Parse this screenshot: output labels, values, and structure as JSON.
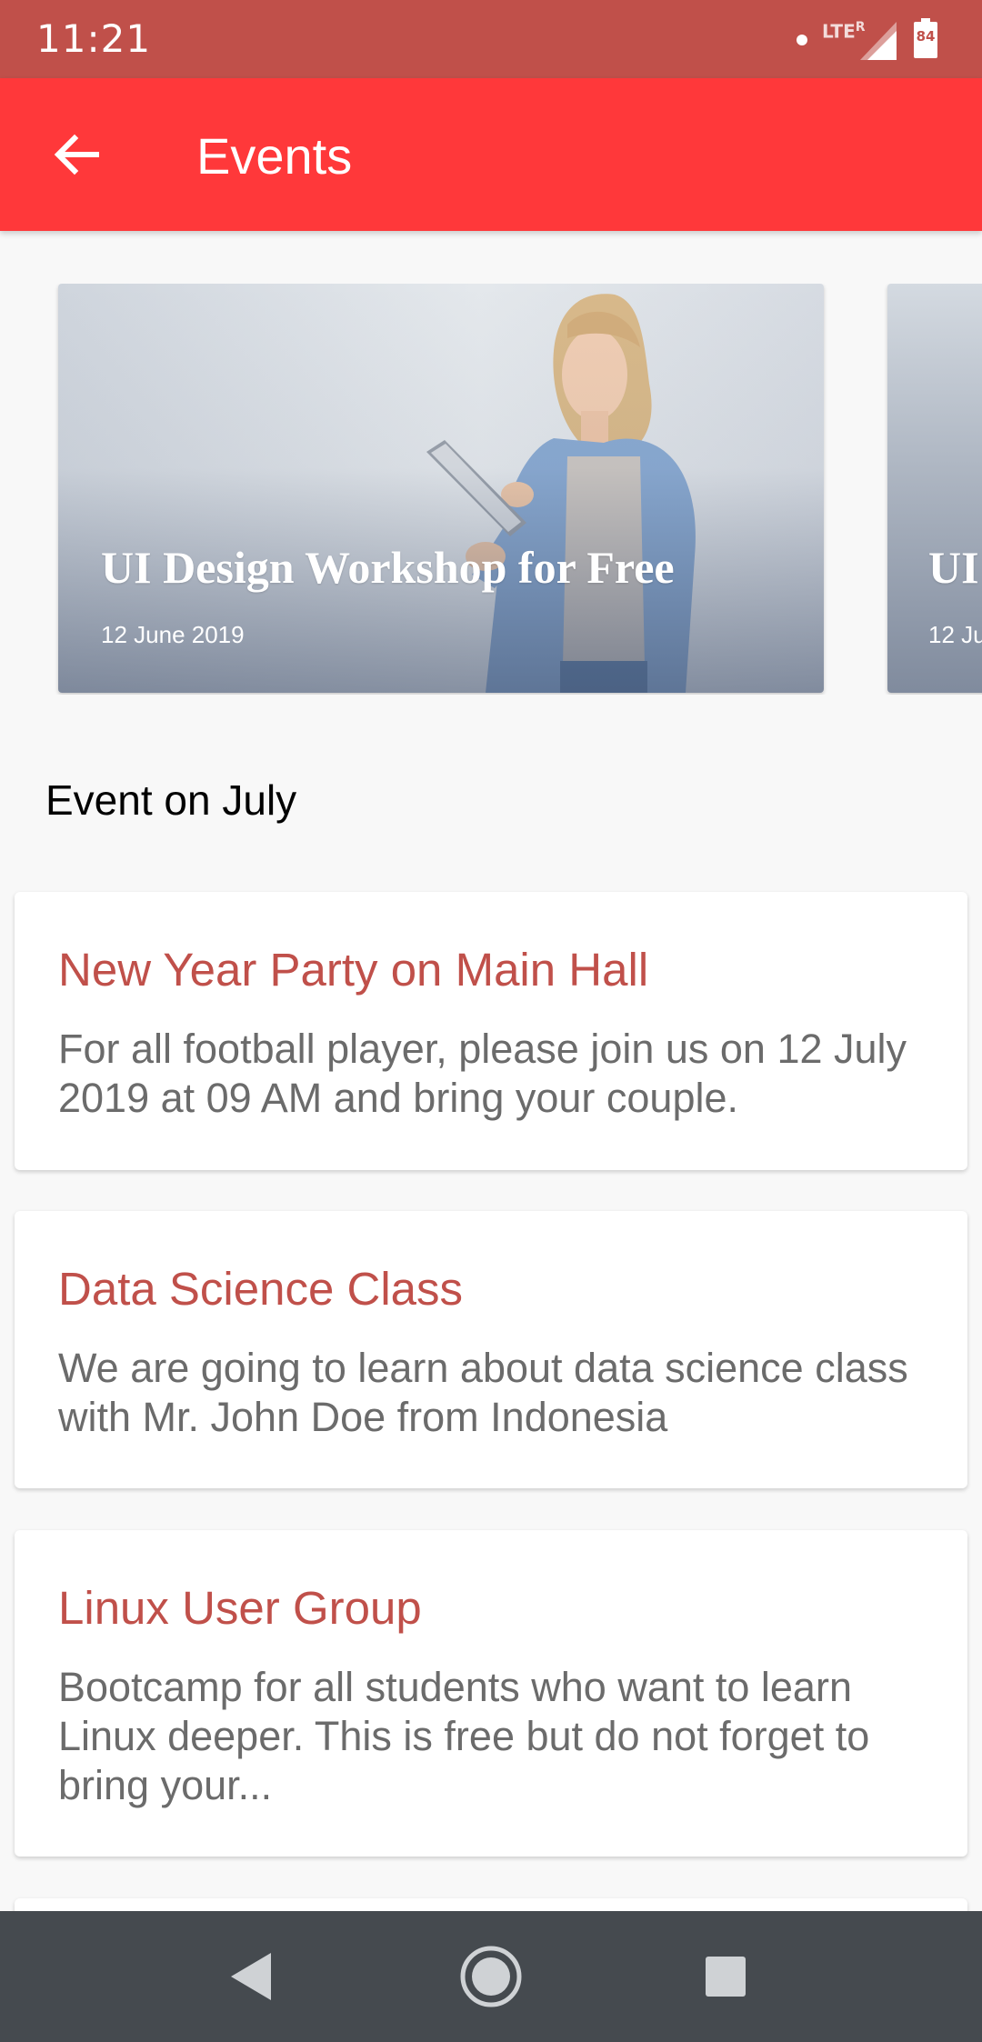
{
  "status_bar": {
    "time": "11:21",
    "network_label": "LTE",
    "roaming_label": "R",
    "battery_level": "84"
  },
  "app_bar": {
    "title": "Events",
    "back_icon": "arrow-left-icon"
  },
  "carousel": {
    "banners": [
      {
        "title": "UI Design Workshop for Free",
        "date": "12 June 2019"
      },
      {
        "title": "UI",
        "date": "12 Ju"
      }
    ]
  },
  "section": {
    "title": "Event on July"
  },
  "events": [
    {
      "title": "New Year Party on Main Hall",
      "description": "For all football player, please join us on 12 July 2019 at 09 AM and bring your couple."
    },
    {
      "title": "Data Science Class",
      "description": "We are going to learn about data science class with Mr. John Doe from Indonesia"
    },
    {
      "title": "Linux User Group",
      "description": "Bootcamp for all students who want to learn Linux deeper. This is free but do not forget to bring your..."
    }
  ],
  "nav_bar": {
    "back_icon": "triangle-back-icon",
    "home_icon": "circle-home-icon",
    "recents_icon": "square-recents-icon"
  },
  "colors": {
    "status_bar": "#c0504a",
    "app_bar": "#ff383a",
    "event_title": "#c0504a",
    "event_text": "#6b6b6b",
    "nav_bar": "#454a4f"
  }
}
